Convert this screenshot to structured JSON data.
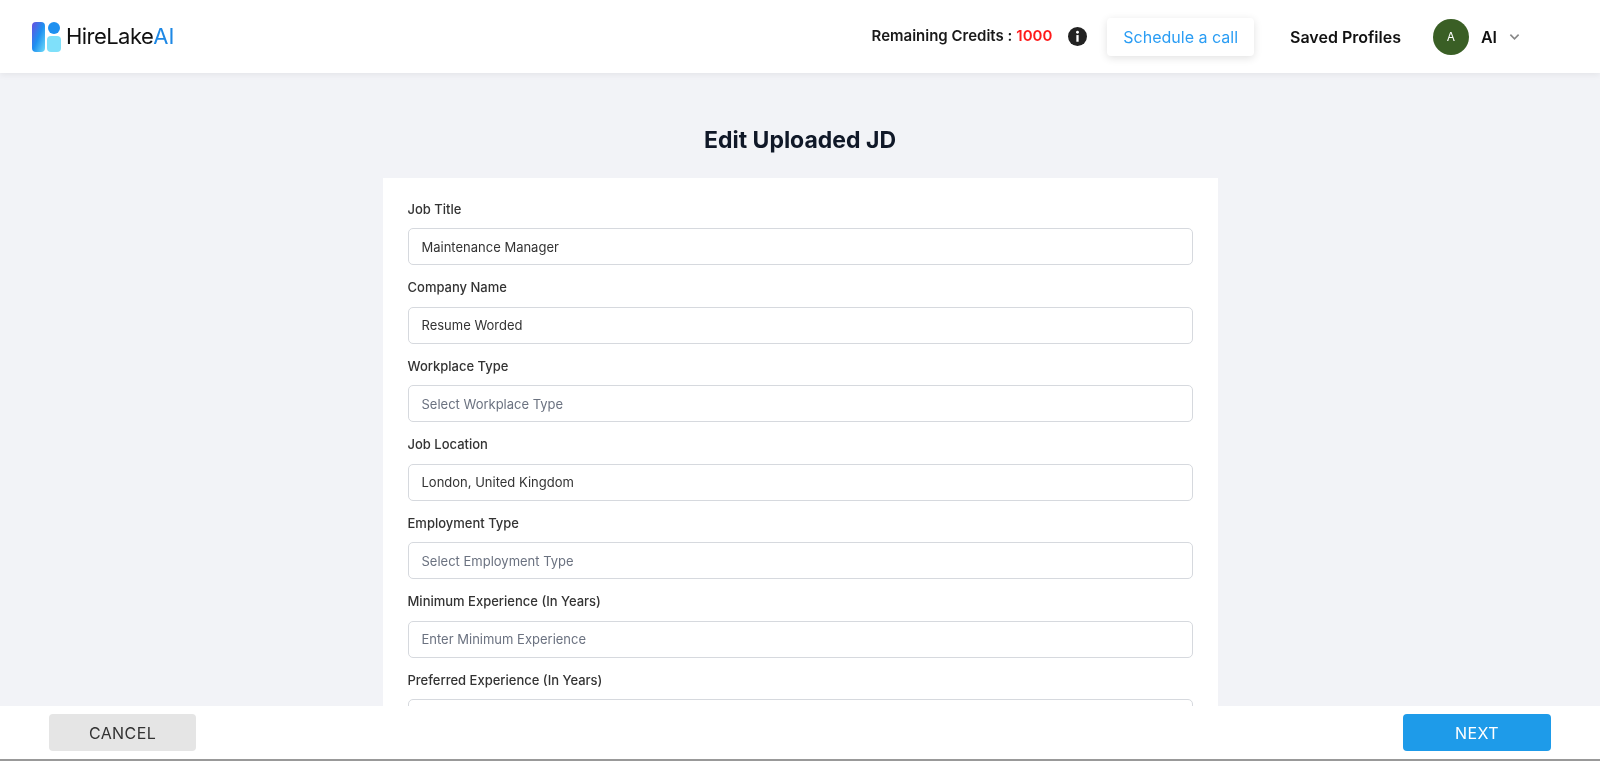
{
  "header": {
    "brand": {
      "name": "HireLake",
      "suffix": "AI"
    },
    "credits": {
      "label": "Remaining Credits :",
      "value": "1000"
    },
    "schedule_button": "Schedule a call",
    "saved_profiles": "Saved Profiles",
    "user": {
      "initial": "A",
      "name": "AI"
    }
  },
  "page_title": "Edit Uploaded JD",
  "fields": [
    {
      "label": "Job Title",
      "value": "Maintenance Manager"
    },
    {
      "label": "Company Name",
      "value": "Resume Worded"
    },
    {
      "label": "Workplace Type",
      "placeholder": "Select Workplace Type"
    },
    {
      "label": "Job Location",
      "value": "London, United Kingdom"
    },
    {
      "label": "Employment Type",
      "placeholder": "Select Employment Type"
    },
    {
      "label": "Minimum Experience (In Years)",
      "placeholder": "Enter Minimum Experience"
    },
    {
      "label": "Preferred Experience (In Years)"
    }
  ],
  "footer": {
    "cancel": "CANCEL",
    "next": "NEXT"
  }
}
